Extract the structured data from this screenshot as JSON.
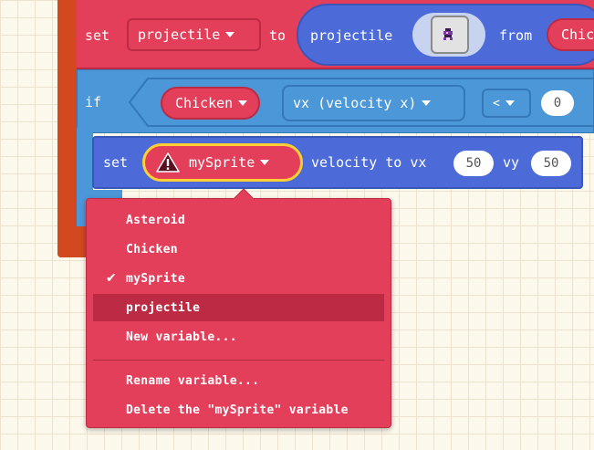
{
  "blocks": {
    "set_projectile": {
      "set_label": "set",
      "variable": "projectile",
      "to_label": "to",
      "func_label": "projectile",
      "from_label": "from",
      "from_value": "Chic"
    },
    "if_block": {
      "if_label": "if",
      "sprite": "Chicken",
      "property": "vx (velocity x)",
      "operator": "<",
      "value": "0"
    },
    "set_velocity": {
      "set_label": "set",
      "sprite": "mySprite",
      "velocity_label": "velocity to vx",
      "vx": "50",
      "vy_label": "vy",
      "vy": "50"
    }
  },
  "dropdown": {
    "items": [
      {
        "label": "Asteroid",
        "checked": false,
        "highlighted": false
      },
      {
        "label": "Chicken",
        "checked": false,
        "highlighted": false
      },
      {
        "label": "mySprite",
        "checked": true,
        "highlighted": false
      },
      {
        "label": "projectile",
        "checked": false,
        "highlighted": true
      },
      {
        "label": "New variable...",
        "checked": false,
        "highlighted": false
      }
    ],
    "actions": [
      {
        "label": "Rename variable..."
      },
      {
        "label": "Delete the \"mySprite\" variable"
      }
    ],
    "check_glyph": "✔"
  },
  "colors": {
    "sprite_block": "#e43f5a",
    "sprite_block_dark": "#bd2a44",
    "logic_block": "#4c97d8",
    "logic_block_dark": "#3578b8",
    "physics_block": "#4c6bd9",
    "loop_block": "#d2481f",
    "warning": "#ffcf33"
  }
}
